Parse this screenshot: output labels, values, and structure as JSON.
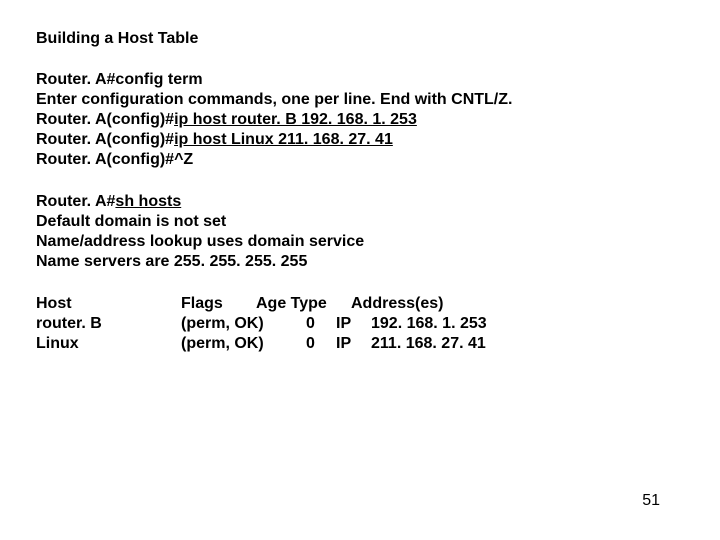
{
  "title": "Building a Host Table",
  "config_block": {
    "prompt1_pre": "Router. A#",
    "prompt1_cmd": "config term",
    "instruction": "Enter configuration commands, one per line.  End with CNTL/Z.",
    "line2_pre": "Router. A(config)#",
    "line2_cmd": "ip host router. B 192. 168. 1. 253",
    "line3_pre": "Router. A(config)#",
    "line3_cmd": "ip host Linux 211. 168. 27. 41",
    "line4": "Router. A(config)#^Z"
  },
  "show_block": {
    "prompt_pre": "Router. A#",
    "prompt_cmd": "sh hosts",
    "line1": "Default domain is not set",
    "line2": "Name/address lookup uses domain service",
    "line3": "Name servers are 255. 255. 255. 255"
  },
  "table": {
    "headers": {
      "host": "Host",
      "flags": "Flags",
      "agetype": "Age Type",
      "addr": "Address(es)"
    },
    "rows": [
      {
        "host": "router. B",
        "flags": "(perm, OK)",
        "age": "0",
        "type": "IP",
        "addr": "192. 168. 1. 253"
      },
      {
        "host": "Linux",
        "flags": "(perm, OK)",
        "age": "0",
        "type": "IP",
        "addr": "211. 168. 27. 41"
      }
    ]
  },
  "page_number": "51"
}
